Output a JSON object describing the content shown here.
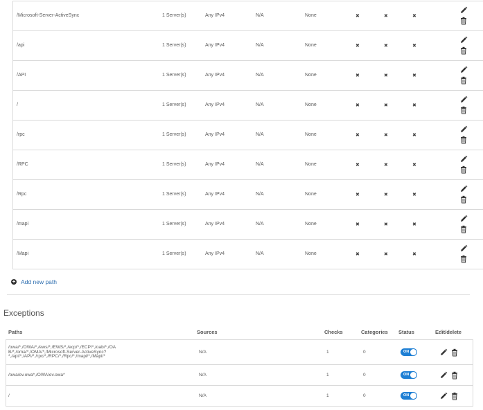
{
  "paths": [
    {
      "path": "/Microsoft-Server-ActiveSync",
      "servers": "1 Server(s)",
      "ip": "Any IPv4",
      "na": "N/A",
      "none": "None",
      "x1": "✖",
      "x2": "✖",
      "x3": "✖"
    },
    {
      "path": "/api",
      "servers": "1 Server(s)",
      "ip": "Any IPv4",
      "na": "N/A",
      "none": "None",
      "x1": "✖",
      "x2": "✖",
      "x3": "✖"
    },
    {
      "path": "/API",
      "servers": "1 Server(s)",
      "ip": "Any IPv4",
      "na": "N/A",
      "none": "None",
      "x1": "✖",
      "x2": "✖",
      "x3": "✖"
    },
    {
      "path": "/",
      "servers": "1 Server(s)",
      "ip": "Any IPv4",
      "na": "N/A",
      "none": "None",
      "x1": "✖",
      "x2": "✖",
      "x3": "✖"
    },
    {
      "path": "/rpc",
      "servers": "1 Server(s)",
      "ip": "Any IPv4",
      "na": "N/A",
      "none": "None",
      "x1": "✖",
      "x2": "✖",
      "x3": "✖"
    },
    {
      "path": "/RPC",
      "servers": "1 Server(s)",
      "ip": "Any IPv4",
      "na": "N/A",
      "none": "None",
      "x1": "✖",
      "x2": "✖",
      "x3": "✖"
    },
    {
      "path": "/Rpc",
      "servers": "1 Server(s)",
      "ip": "Any IPv4",
      "na": "N/A",
      "none": "None",
      "x1": "✖",
      "x2": "✖",
      "x3": "✖"
    },
    {
      "path": "/mapi",
      "servers": "1 Server(s)",
      "ip": "Any IPv4",
      "na": "N/A",
      "none": "None",
      "x1": "✖",
      "x2": "✖",
      "x3": "✖"
    },
    {
      "path": "/Mapi",
      "servers": "1 Server(s)",
      "ip": "Any IPv4",
      "na": "N/A",
      "none": "None",
      "x1": "✖",
      "x2": "✖",
      "x3": "✖"
    }
  ],
  "add_path_label": "Add new path",
  "exceptions": {
    "title": "Exceptions",
    "headers": {
      "paths": "Paths",
      "sources": "Sources",
      "checks": "Checks",
      "categories": "Categories",
      "status": "Status",
      "edit_delete": "Edit/delete"
    },
    "rows": [
      {
        "path_lines": [
          "/owa/*,/OWA/*,/ews/*,/EWS/*,/ecp/*,/ECP/*,/oab/*,/OA",
          "B/*,/oma/*,/OMA/*,/Microsoft-Server-ActiveSync?",
          "*,/api/*,/API/*,/rpc/*,/RPC/*,/Rpc/*,/mapi/*,/Mapi/*"
        ],
        "sources": "N/A",
        "checks": "1",
        "categories": "0",
        "status": "ON"
      },
      {
        "path_lines": [
          "/owa/ev.owa*,/OWA/ev.owa*"
        ],
        "sources": "N/A",
        "checks": "1",
        "categories": "0",
        "status": "ON"
      },
      {
        "path_lines": [
          "/"
        ],
        "sources": "N/A",
        "checks": "1",
        "categories": "0",
        "status": "ON"
      }
    ]
  },
  "colors": {
    "accent": "#1e7fd4",
    "link": "#2f6fb0",
    "border": "#d9d9d9"
  },
  "icons": {
    "edit": "pencil-icon",
    "delete": "trash-icon",
    "add": "plus-circle-icon"
  }
}
